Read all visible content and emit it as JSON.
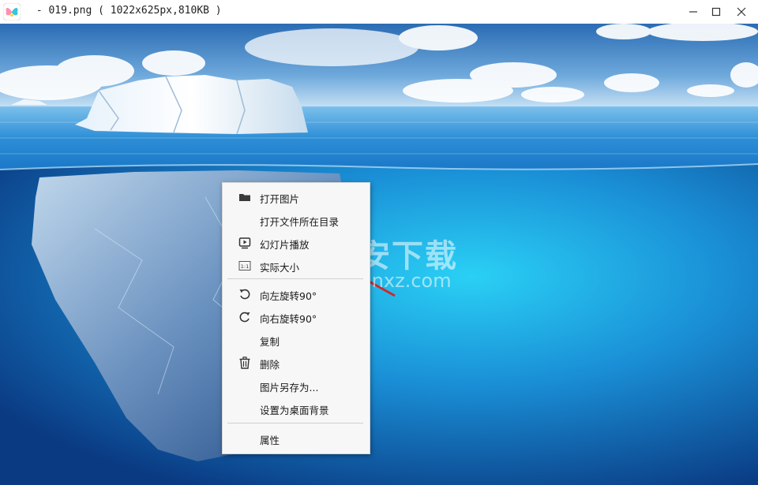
{
  "window": {
    "title": " - 019.png ( 1022x625px,810KB )"
  },
  "image": {
    "description_icon": "iceberg-photo"
  },
  "context_menu": {
    "items": [
      {
        "label": "打开图片",
        "icon": "folder-icon"
      },
      {
        "label": "打开文件所在目录",
        "icon": ""
      },
      {
        "label": "幻灯片播放",
        "icon": "slideshow-play-icon"
      },
      {
        "label": "实际大小",
        "icon": "actual-size-icon"
      },
      {
        "label": "向左旋转90°",
        "icon": "rotate-left-icon"
      },
      {
        "label": "向右旋转90°",
        "icon": "rotate-right-icon"
      },
      {
        "label": "复制",
        "icon": ""
      },
      {
        "label": "删除",
        "icon": "trash-icon"
      },
      {
        "label": "图片另存为...",
        "icon": ""
      },
      {
        "label": "设置为桌面背景",
        "icon": ""
      },
      {
        "label": "属性",
        "icon": ""
      }
    ]
  },
  "watermark": {
    "cn": "安下载",
    "en": "anxz.com"
  },
  "colors": {
    "arrow": "#d0282b",
    "sky_top": "#2f6fb5",
    "ocean_deep": "#0b3f86"
  }
}
